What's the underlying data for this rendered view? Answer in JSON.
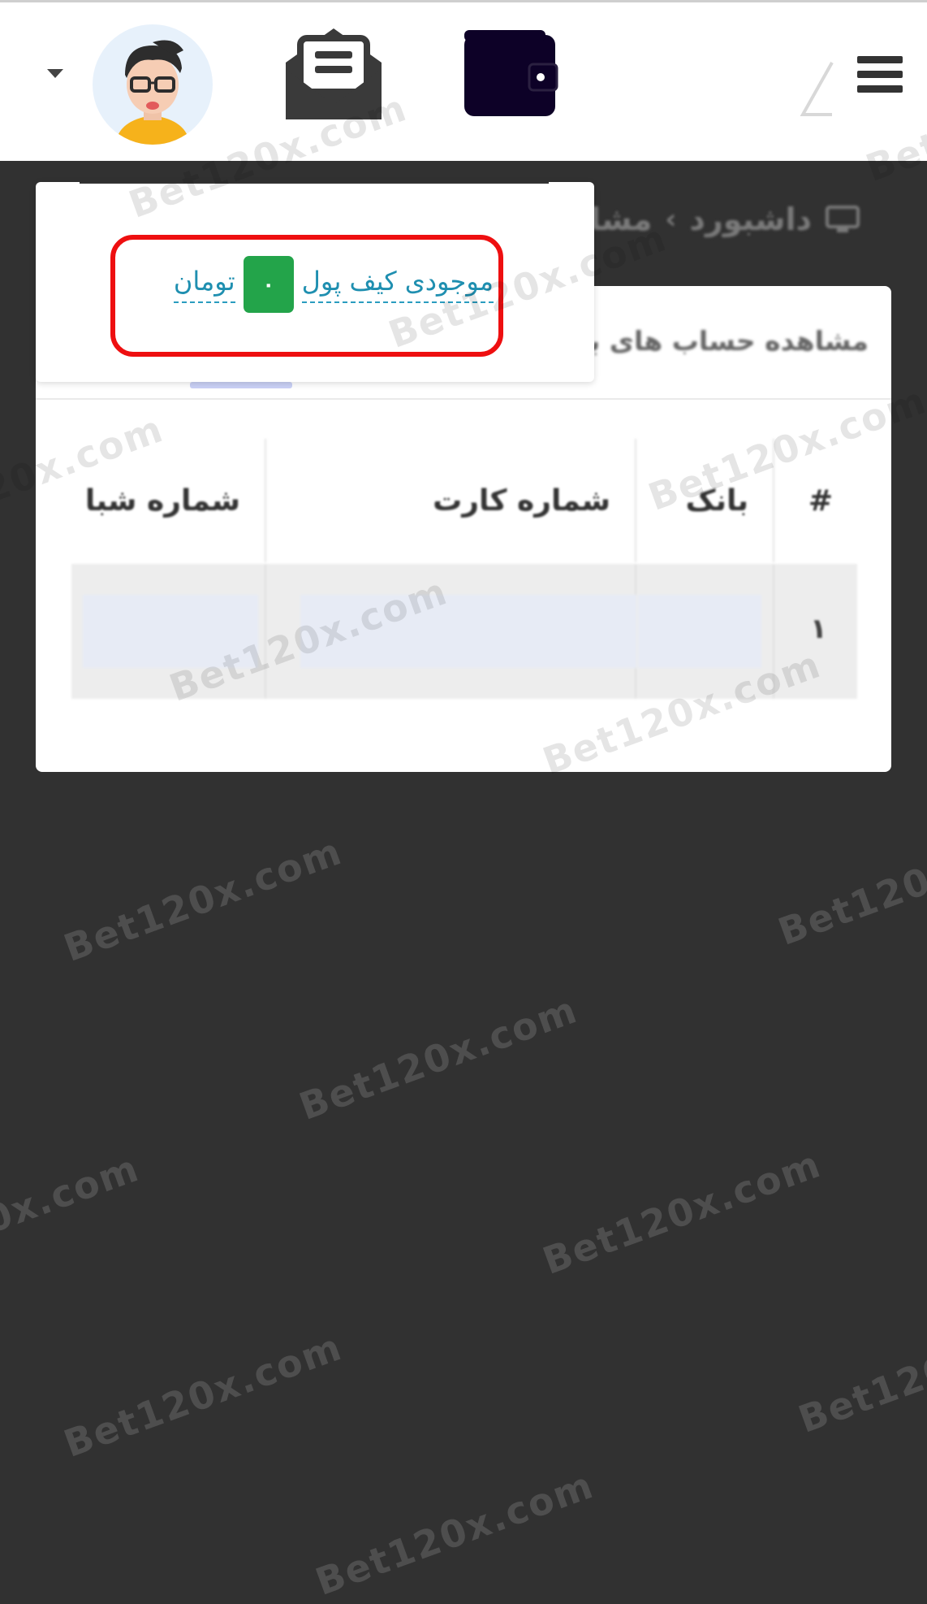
{
  "header": {
    "menu_icon": "hamburger-icon",
    "wallet_icon": "wallet-icon",
    "messages_icon": "envelope-letter-icon",
    "avatar_icon": "user-avatar",
    "dropdown_icon": "caret-down-icon"
  },
  "breadcrumb": {
    "home_icon": "monitor-icon",
    "home_label": "داشبورد",
    "separator": "›",
    "current_label": "مشا"
  },
  "card": {
    "title": "مشاهده حساب های با"
  },
  "table": {
    "headers": [
      "#",
      "بانک",
      "شماره کارت",
      "شماره شبا"
    ],
    "rows": [
      {
        "num": "۱",
        "bank": "",
        "card_number": "",
        "sheba": ""
      }
    ]
  },
  "wallet_dropdown": {
    "label": "موجودی کیف پول",
    "balance": "۰",
    "currency": "تومان"
  },
  "watermark": "Bet120x.com",
  "colors": {
    "background": "#313131",
    "badge": "#23a44a",
    "link": "#1f8fb0",
    "highlight": "#ee0f10"
  }
}
